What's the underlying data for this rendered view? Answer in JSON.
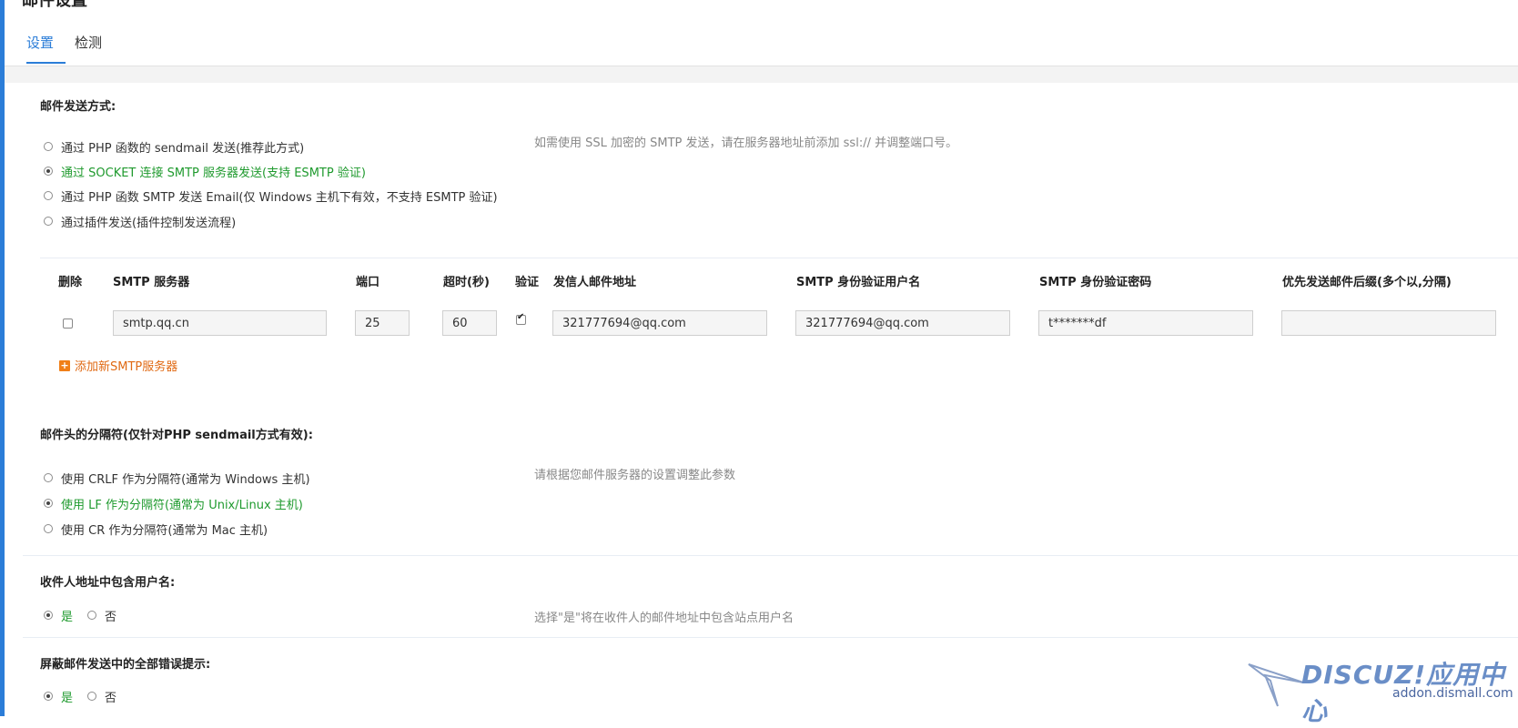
{
  "page": {
    "title": "邮件设置"
  },
  "tabs": [
    {
      "label": "设置"
    },
    {
      "label": "检测"
    }
  ],
  "send_method": {
    "title": "邮件发送方式:",
    "hint": "如需使用 SSL 加密的 SMTP 发送，请在服务器地址前添加 ssl:// 并调整端口号。",
    "options": [
      "通过 PHP 函数的 sendmail 发送(推荐此方式)",
      "通过 SOCKET 连接 SMTP 服务器发送(支持 ESMTP 验证)",
      "通过 PHP 函数 SMTP 发送 Email(仅 Windows 主机下有效，不支持 ESMTP 验证)",
      "通过插件发送(插件控制发送流程)"
    ],
    "selected_index": 1
  },
  "smtp_table": {
    "headers": {
      "delete": "删除",
      "server": "SMTP 服务器",
      "port": "端口",
      "timeout": "超时(秒)",
      "auth": "验证",
      "from": "发信人邮件地址",
      "username": "SMTP 身份验证用户名",
      "password": "SMTP 身份验证密码",
      "suffix": "优先发送邮件后缀(多个以,分隔)"
    },
    "row": {
      "delete_checked": false,
      "server": "smtp.qq.cn",
      "port": "25",
      "timeout": "60",
      "auth_checked": true,
      "from": "321777694@qq.com",
      "username": "321777694@qq.com",
      "password": "t*******df",
      "suffix": ""
    },
    "add_label": "添加新SMTP服务器"
  },
  "separator": {
    "title": "邮件头的分隔符(仅针对PHP sendmail方式有效):",
    "hint": "请根据您邮件服务器的设置调整此参数",
    "options": [
      "使用 CRLF 作为分隔符(通常为 Windows 主机)",
      "使用 LF 作为分隔符(通常为 Unix/Linux 主机)",
      "使用 CR 作为分隔符(通常为 Mac 主机)"
    ],
    "selected_index": 1
  },
  "include_username": {
    "title": "收件人地址中包含用户名:",
    "yes": "是",
    "no": "否",
    "value": "yes",
    "hint": "选择\"是\"将在收件人的邮件地址中包含站点用户名"
  },
  "hide_errors": {
    "title": "屏蔽邮件发送中的全部错误提示:",
    "yes": "是",
    "no": "否",
    "value": "yes"
  },
  "watermark": {
    "brand": "DISCUZ!应用中心",
    "url": "addon.dismall.com"
  },
  "colors": {
    "accent": "#2b7dd8",
    "selected_text": "#1f9a2e",
    "add_link": "#e06a14"
  }
}
